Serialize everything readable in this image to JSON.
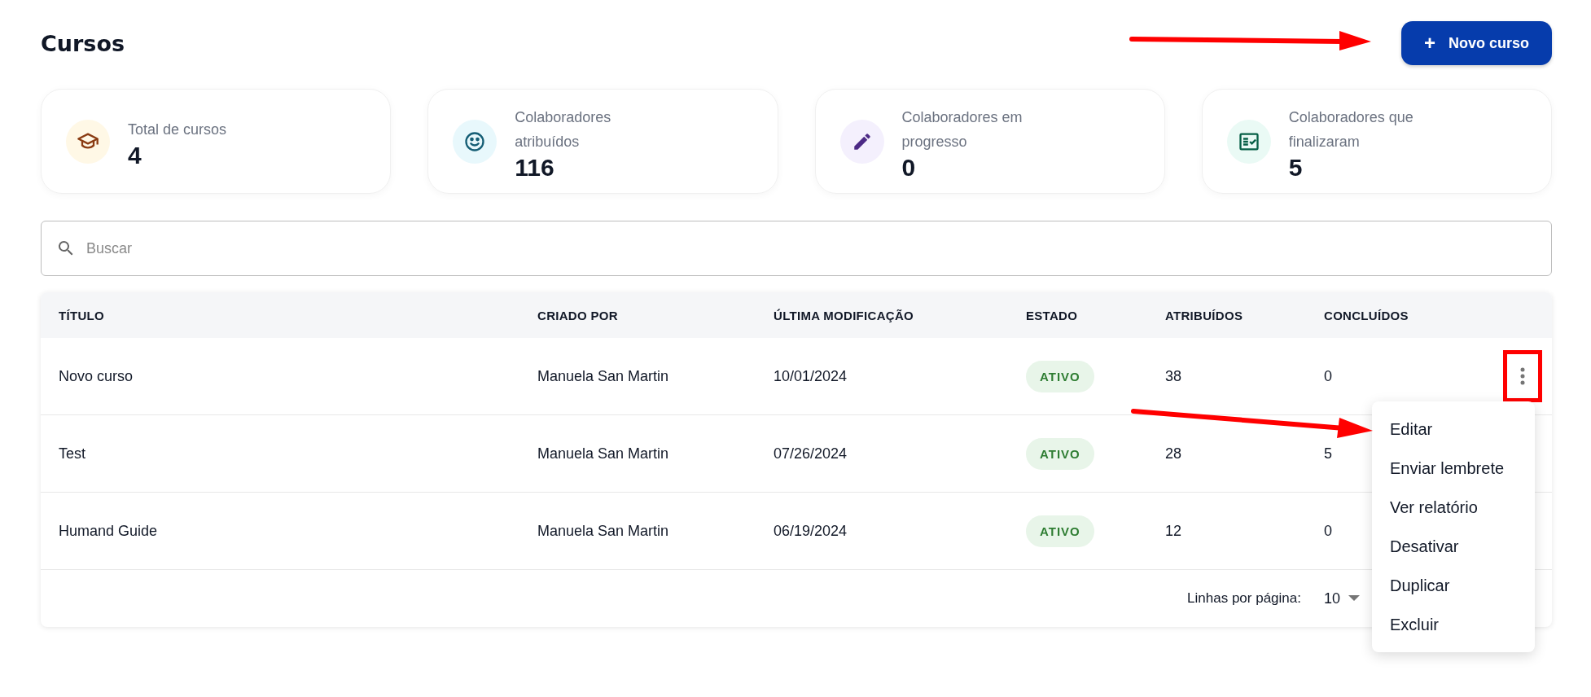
{
  "page": {
    "title": "Cursos"
  },
  "new_button": {
    "icon": "+",
    "label": "Novo curso"
  },
  "stats": [
    {
      "kind": "cap",
      "label": "Total de cursos",
      "value": "4",
      "color": "#fff8e6"
    },
    {
      "kind": "smile",
      "label": "Colaboradores atribuídos",
      "value": "116",
      "color": "#e8f8fc"
    },
    {
      "kind": "pencil",
      "label": "Colaboradores em progresso",
      "value": "0",
      "color": "#f4f0fd"
    },
    {
      "kind": "checklist",
      "label": "Colaboradores que finalizaram",
      "value": "5",
      "color": "#eafaf5"
    }
  ],
  "search": {
    "placeholder": "Buscar"
  },
  "table": {
    "columns": [
      "TÍTULO",
      "CRIADO POR",
      "ÚLTIMA MODIFICAÇÃO",
      "ESTADO",
      "ATRIBUÍDOS",
      "CONCLUÍDOS"
    ],
    "rows": [
      {
        "title": "Novo curso",
        "created_by": "Manuela San Martin",
        "modified": "10/01/2024",
        "status": "ATIVO",
        "assigned": "38",
        "completed": "0",
        "menu_highlighted": true
      },
      {
        "title": "Test",
        "created_by": "Manuela San Martin",
        "modified": "07/26/2024",
        "status": "ATIVO",
        "assigned": "28",
        "completed": "5",
        "menu_highlighted": false
      },
      {
        "title": "Humand Guide",
        "created_by": "Manuela San Martin",
        "modified": "06/19/2024",
        "status": "ATIVO",
        "assigned": "12",
        "completed": "0",
        "menu_highlighted": false
      }
    ],
    "pagination": {
      "label": "Linhas por página:",
      "value": "10"
    }
  },
  "context_menu": {
    "items": [
      "Editar",
      "Enviar lembrete",
      "Ver relatório",
      "Desativar",
      "Duplicar",
      "Excluir"
    ]
  }
}
